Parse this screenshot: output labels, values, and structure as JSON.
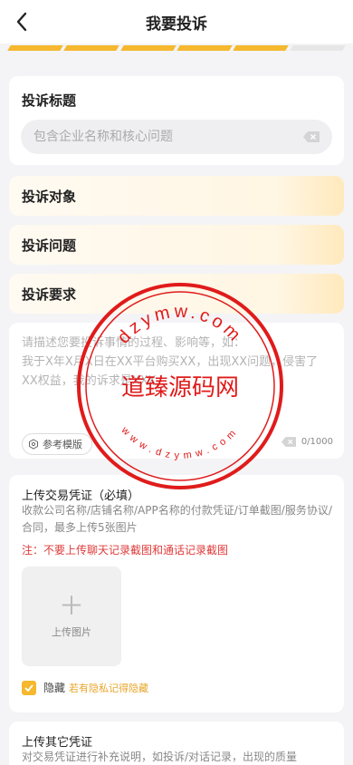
{
  "header": {
    "title": "我要投诉",
    "back_icon": "chevron-left-icon"
  },
  "progress": {
    "total_steps": 6,
    "completed_steps": 5,
    "active_color": "#f5b82e"
  },
  "complaint_title": {
    "label": "投诉标题",
    "placeholder": "包含企业名称和核心问题",
    "value": ""
  },
  "sections": [
    {
      "label": "投诉对象"
    },
    {
      "label": "投诉问题"
    },
    {
      "label": "投诉要求"
    }
  ],
  "description": {
    "placeholder": "请描述您要投诉事情的过程、影响等，如：\n我于X年X月X日在XX平台购买XX，出现XX问题，侵害了XX权益，我的诉求是XXX。",
    "value": "",
    "template_button": "参考模版",
    "counter": "0/1000"
  },
  "upload_transaction": {
    "title": "上传交易凭证（必填）",
    "description": "收款公司名称/店铺名称/APP名称的付款凭证/订单截图/服务协议/合同，最多上传5张图片",
    "note": "注：不要上传聊天记录截图和通话记录截图",
    "upload_label": "上传图片",
    "hide_label": "隐藏",
    "hide_hint": "若有隐私记得隐藏",
    "hide_checked": true
  },
  "upload_other": {
    "title": "上传其它凭证",
    "description": "对交易凭证进行补充说明，如投诉/对话记录，出现的质量"
  },
  "watermark": {
    "top_text": "dzymw.com",
    "center_text": "道臻源码网",
    "bottom_text": "www.dzymw.com",
    "color": "#e01b1b"
  }
}
